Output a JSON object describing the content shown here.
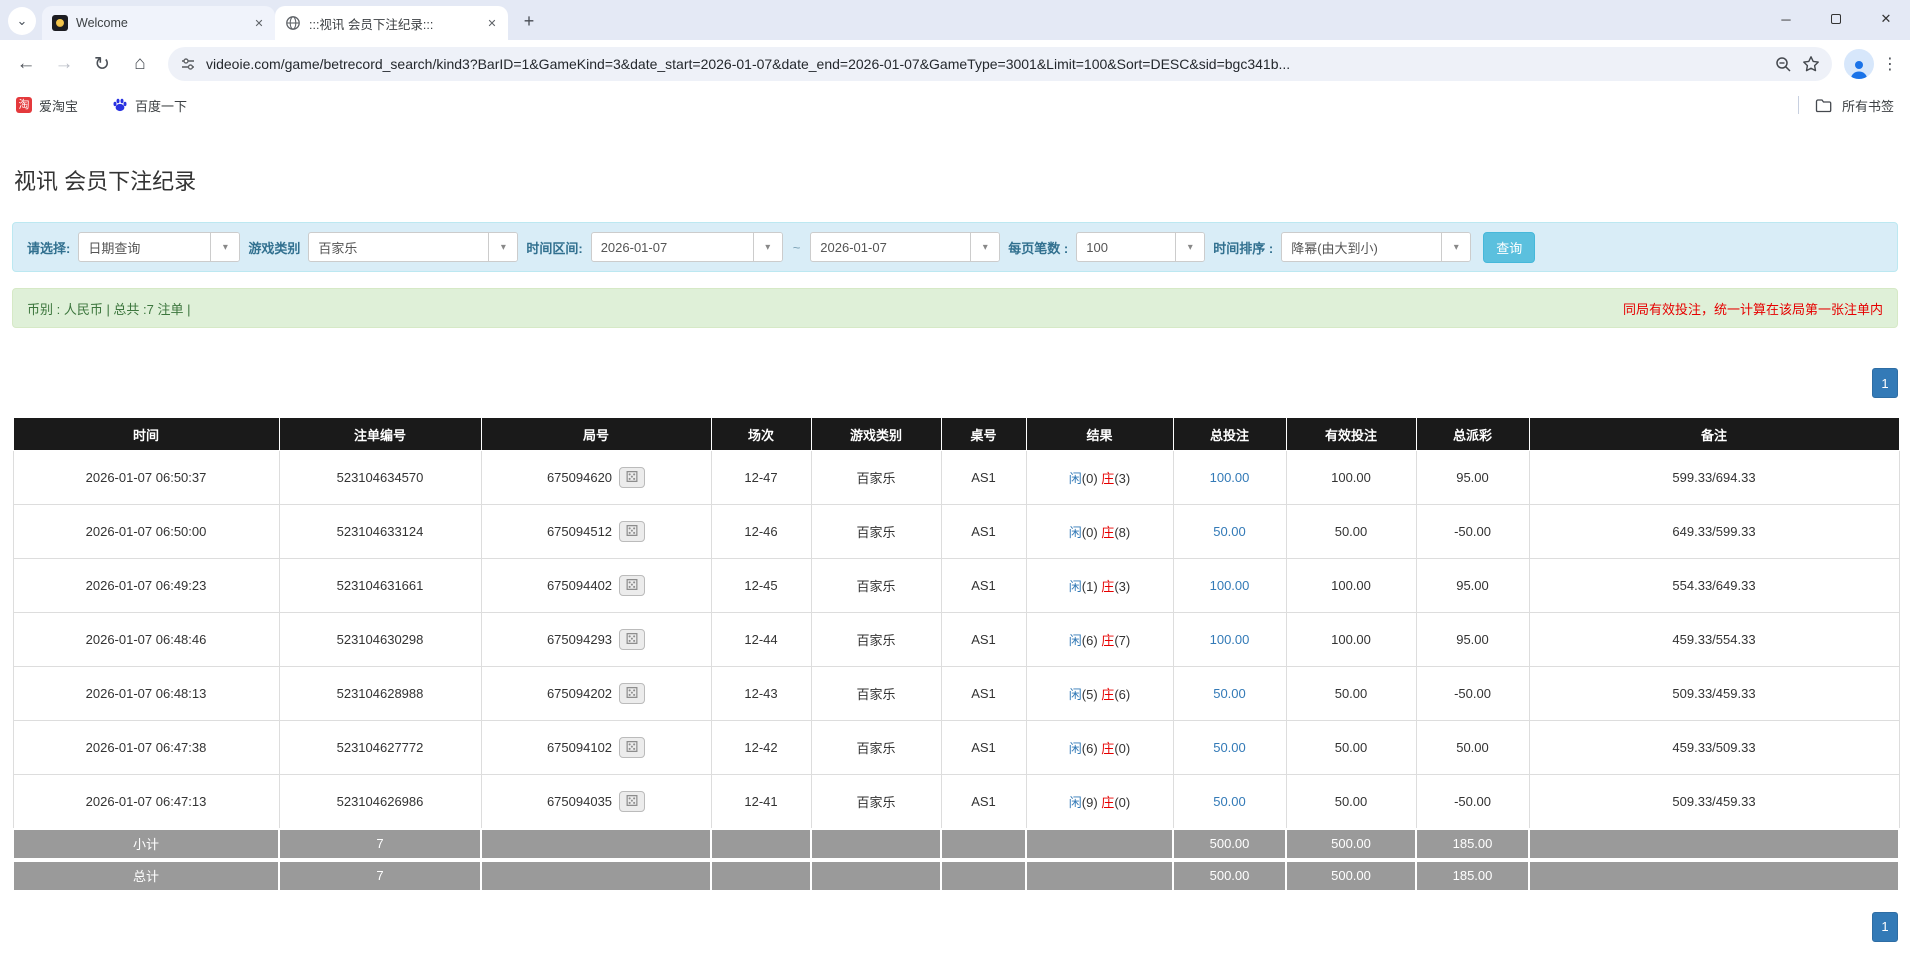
{
  "icons": {
    "chevron_down": "⌄",
    "close": "✕",
    "plus": "+",
    "minimize": "─",
    "back": "←",
    "forward": "→",
    "reload": "↻",
    "home": "⌂",
    "kebab": "⋮",
    "caret": "▾",
    "dice": "⚄",
    "taobao_glyph": "淘"
  },
  "browser": {
    "tabs": [
      {
        "title": "Welcome"
      },
      {
        "title": ":::视讯 会员下注纪录:::"
      }
    ],
    "url": "videoie.com/game/betrecord_search/kind3?BarID=1&GameKind=3&date_start=2026-01-07&date_end=2026-01-07&GameType=3001&Limit=100&Sort=DESC&sid=bgc341b...",
    "bookmarks": [
      {
        "label": "爱淘宝"
      },
      {
        "label": "百度一下"
      }
    ],
    "all_bookmarks_label": "所有书签"
  },
  "page": {
    "title": "视讯 会员下注纪录",
    "filters": {
      "select_label": "请选择:",
      "select_value": "日期查询",
      "game_kind_label": "游戏类别",
      "game_kind_value": "百家乐",
      "date_range_label": "时间区间:",
      "date_start": "2026-01-07",
      "tilde": "~",
      "date_end": "2026-01-07",
      "per_page_label": "每页笔数 :",
      "per_page_value": "100",
      "sort_label": "时间排序 :",
      "sort_value": "降幂(由大到小)",
      "search_button": "查询"
    },
    "summary": {
      "left": "币别 : 人民币 | 总共 :7 注单 |",
      "right": "同局有效投注，统一计算在该局第一张注单内"
    },
    "pagination": {
      "page": "1"
    },
    "table": {
      "headers": [
        "时间",
        "注单编号",
        "局号",
        "场次",
        "游戏类别",
        "桌号",
        "结果",
        "总投注",
        "有效投注",
        "总派彩",
        "备注"
      ],
      "rows": [
        {
          "time": "2026-01-07 06:50:37",
          "bet_id": "523104634570",
          "round_id": "675094620",
          "session": "12-47",
          "game": "百家乐",
          "table": "AS1",
          "player": "闲(0)",
          "banker": "庄(3)",
          "total_bet": "100.00",
          "valid_bet": "100.00",
          "payout": "95.00",
          "note": "599.33/694.33"
        },
        {
          "time": "2026-01-07 06:50:00",
          "bet_id": "523104633124",
          "round_id": "675094512",
          "session": "12-46",
          "game": "百家乐",
          "table": "AS1",
          "player": "闲(0)",
          "banker": "庄(8)",
          "total_bet": "50.00",
          "valid_bet": "50.00",
          "payout": "-50.00",
          "note": "649.33/599.33"
        },
        {
          "time": "2026-01-07 06:49:23",
          "bet_id": "523104631661",
          "round_id": "675094402",
          "session": "12-45",
          "game": "百家乐",
          "table": "AS1",
          "player": "闲(1)",
          "banker": "庄(3)",
          "total_bet": "100.00",
          "valid_bet": "100.00",
          "payout": "95.00",
          "note": "554.33/649.33"
        },
        {
          "time": "2026-01-07 06:48:46",
          "bet_id": "523104630298",
          "round_id": "675094293",
          "session": "12-44",
          "game": "百家乐",
          "table": "AS1",
          "player": "闲(6)",
          "banker": "庄(7)",
          "total_bet": "100.00",
          "valid_bet": "100.00",
          "payout": "95.00",
          "note": "459.33/554.33"
        },
        {
          "time": "2026-01-07 06:48:13",
          "bet_id": "523104628988",
          "round_id": "675094202",
          "session": "12-43",
          "game": "百家乐",
          "table": "AS1",
          "player": "闲(5)",
          "banker": "庄(6)",
          "total_bet": "50.00",
          "valid_bet": "50.00",
          "payout": "-50.00",
          "note": "509.33/459.33"
        },
        {
          "time": "2026-01-07 06:47:38",
          "bet_id": "523104627772",
          "round_id": "675094102",
          "session": "12-42",
          "game": "百家乐",
          "table": "AS1",
          "player": "闲(6)",
          "banker": "庄(0)",
          "total_bet": "50.00",
          "valid_bet": "50.00",
          "payout": "50.00",
          "note": "459.33/509.33"
        },
        {
          "time": "2026-01-07 06:47:13",
          "bet_id": "523104626986",
          "round_id": "675094035",
          "session": "12-41",
          "game": "百家乐",
          "table": "AS1",
          "player": "闲(9)",
          "banker": "庄(0)",
          "total_bet": "50.00",
          "valid_bet": "50.00",
          "payout": "-50.00",
          "note": "509.33/459.33"
        }
      ],
      "subtotal": {
        "label": "小计",
        "count": "7",
        "total_bet": "500.00",
        "valid_bet": "500.00",
        "payout": "185.00"
      },
      "total": {
        "label": "总计",
        "count": "7",
        "total_bet": "500.00",
        "valid_bet": "500.00",
        "payout": "185.00"
      }
    }
  },
  "colors": {
    "accent_blue": "#337ab7",
    "negative_red": "#e60000",
    "header_bg": "#1a1a1a",
    "search_button_bg": "#5bc0de",
    "filter_bar_bg": "#d9edf7",
    "summary_bar_bg": "#dff0d8",
    "footer_row_bg": "#9a9a9a"
  }
}
